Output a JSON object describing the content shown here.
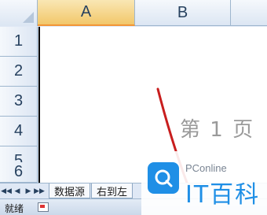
{
  "columns": [
    "A",
    "B"
  ],
  "rows": [
    "1",
    "2",
    "3",
    "4",
    "5",
    "6"
  ],
  "sheet": {
    "page_label": "第 1 页"
  },
  "tabs": {
    "nav": [
      "◀◀",
      "◀",
      "▶",
      "▶▶"
    ],
    "items": [
      "数据源",
      "右到左"
    ]
  },
  "status": {
    "ready": "就绪"
  },
  "watermark": {
    "brand": "PConline",
    "cn": "IT百科"
  },
  "colors": {
    "selected_column": "#f2c76a",
    "accent_blue": "#1f8fe6",
    "stroke_red": "#c81e1e"
  }
}
